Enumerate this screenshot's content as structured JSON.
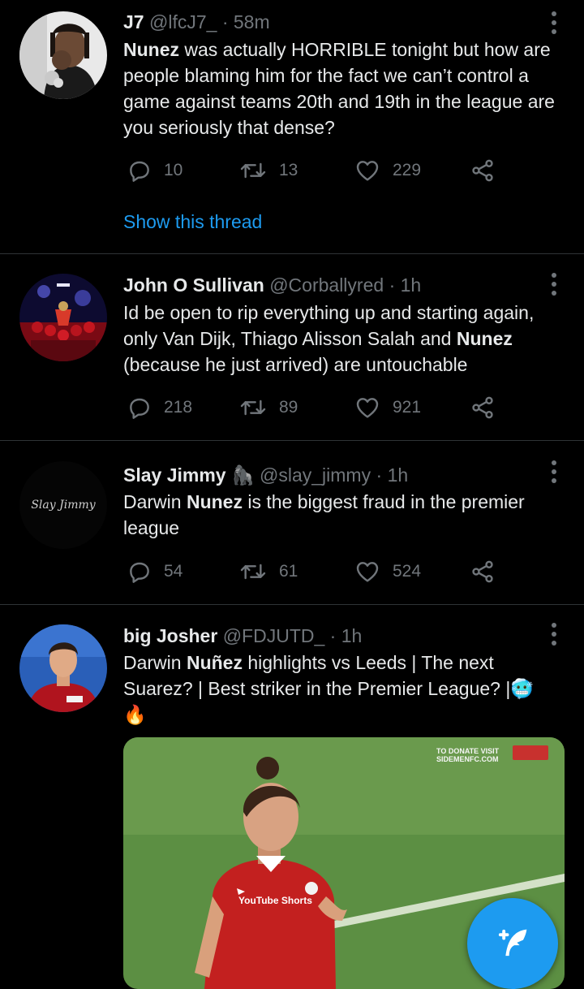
{
  "tweets": [
    {
      "name": "J7",
      "handle": "@lfcJ7_",
      "time": "58m",
      "text_parts": [
        "Nunez",
        " was actually HORRIBLE tonight but how are people blaming him for the fact we can’t control a game against teams 20th and 19th in the league are you seriously that dense?"
      ],
      "replies": "10",
      "retweets": "13",
      "likes": "229",
      "thread_link": "Show this thread"
    },
    {
      "name": "John O Sullivan",
      "handle": "@Corballyred",
      "time": "1h",
      "text_parts": [
        "Id be open to rip everything up and starting again, only Van Dijk, Thiago Alisson Salah and ",
        "Nunez",
        " (because he just arrived) are untouchable"
      ],
      "replies": "218",
      "retweets": "89",
      "likes": "921"
    },
    {
      "name": "Slay Jimmy",
      "name_emoji": "🦍",
      "handle": "@slay_jimmy",
      "time": "1h",
      "avatar_text": "Slay Jimmy",
      "text_parts": [
        "Darwin ",
        "Nunez",
        " is the biggest fraud in the premier league"
      ],
      "replies": "54",
      "retweets": "61",
      "likes": "524"
    },
    {
      "name": "big Josher",
      "handle": "@FDJUTD_",
      "time": "1h",
      "text_parts": [
        "Darwin ",
        "Nuñez",
        " highlights vs Leeds | The next Suarez? | Best striker in the Premier League? |",
        "🥶",
        "🔥"
      ],
      "media_overlay_1": "TO DONATE VISIT",
      "media_overlay_2": "SIDEMENFC.COM",
      "media_badge": "YouTube Shorts"
    }
  ],
  "colors": {
    "background": "#000000",
    "text": "#e7e9ea",
    "muted": "#71767b",
    "accent": "#1d9bf0",
    "divider": "#2f3336"
  },
  "icons": [
    "reply-icon",
    "retweet-icon",
    "like-icon",
    "share-icon",
    "more-icon",
    "compose-icon"
  ]
}
